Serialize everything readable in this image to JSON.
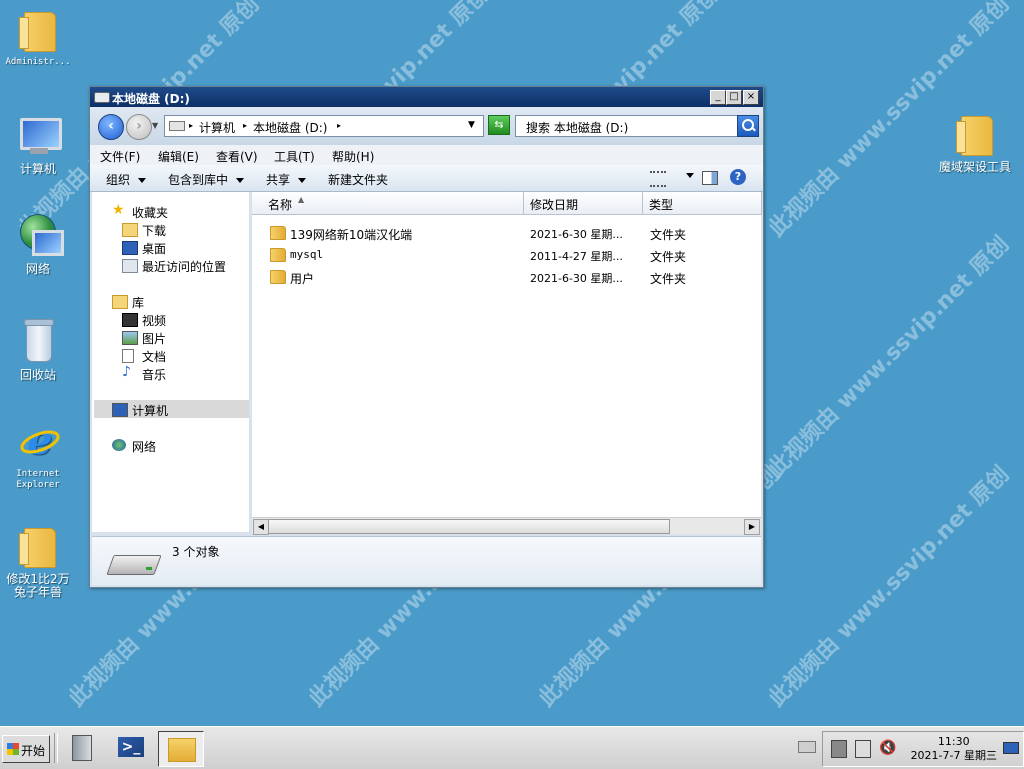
{
  "desktop": {
    "icons": [
      {
        "label": "Administr..."
      },
      {
        "label": "计算机"
      },
      {
        "label": "网络"
      },
      {
        "label": "回收站"
      },
      {
        "label": "Internet Explorer"
      },
      {
        "label": "修改1比2万兔子年兽"
      },
      {
        "label": "魔域架设工具"
      }
    ],
    "watermark": [
      "此视频由 www.ssvip.net 原创"
    ]
  },
  "window": {
    "title": "本地磁盘 (D:)",
    "controls": {
      "minimize": "_",
      "maximize": "□",
      "close": "×"
    },
    "address": {
      "segments": [
        "计算机",
        "本地磁盘 (D:)"
      ]
    },
    "search": {
      "placeholder": "搜索 本地磁盘 (D:)"
    },
    "menu": [
      "文件(F)",
      "编辑(E)",
      "查看(V)",
      "工具(T)",
      "帮助(H)"
    ],
    "commands": [
      "组织",
      "包含到库中",
      "共享",
      "新建文件夹"
    ],
    "nav": {
      "favorites": "收藏夹",
      "fav_items": [
        "下载",
        "桌面",
        "最近访问的位置"
      ],
      "libraries": "库",
      "lib_items": [
        "视频",
        "图片",
        "文档",
        "音乐"
      ],
      "computer": "计算机",
      "network": "网络"
    },
    "columns": [
      "名称",
      "修改日期",
      "类型"
    ],
    "files": [
      {
        "name": "139网络新10端汉化端",
        "date": "2021-6-30 星期...",
        "type": "文件夹"
      },
      {
        "name": "mysql",
        "date": "2011-4-27 星期...",
        "type": "文件夹"
      },
      {
        "name": "用户",
        "date": "2021-6-30 星期...",
        "type": "文件夹"
      }
    ],
    "status": "3 个对象"
  },
  "taskbar": {
    "start": "开始",
    "clock": {
      "time": "11:30",
      "date": "2021-7-7 星期三"
    }
  },
  "colors": {
    "desktop": "#4a9bc9",
    "titlebar": "#0c2f66"
  }
}
